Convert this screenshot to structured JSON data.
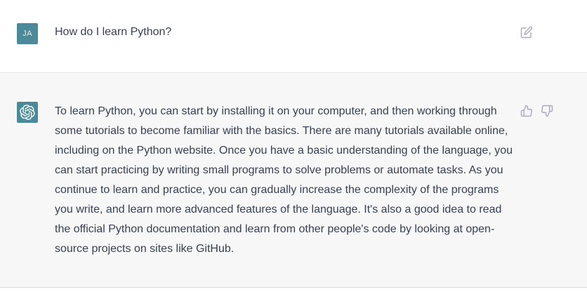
{
  "user_message": {
    "avatar_initials": "JA",
    "text": "How do I learn Python?",
    "edit_icon": "edit-icon"
  },
  "assistant_message": {
    "avatar_icon": "openai-logo-icon",
    "text": "To learn Python, you can start by installing it on your computer, and then working through some tutorials to become familiar with the basics. There are many tutorials available online, including on the Python website. Once you have a basic understanding of the language, you can start practicing by writing small programs to solve problems or automate tasks. As you continue to learn and practice, you can gradually increase the complexity of the programs you write, and learn more advanced features of the language. It's also a good idea to read the official Python documentation and learn from other people's code by looking at open-source projects on sites like GitHub.",
    "feedback_icons": [
      "thumbs-up-icon",
      "thumbs-down-icon"
    ]
  },
  "colors": {
    "avatar": "#4a8a99",
    "assistant_bg": "#f7f7f8",
    "text": "#374151",
    "icon": "#acacbe"
  }
}
